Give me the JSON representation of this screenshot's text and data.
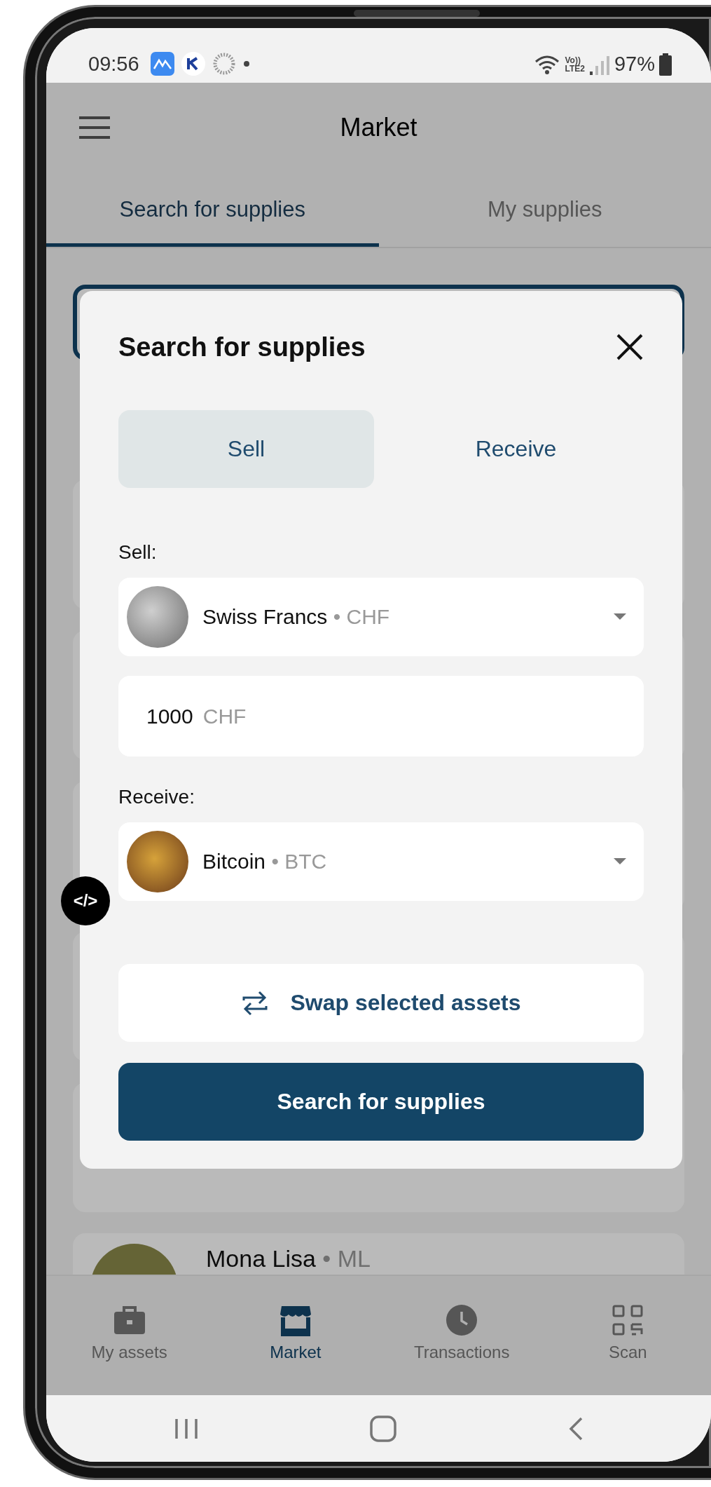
{
  "status_bar": {
    "time": "09:56",
    "network_top": "Vo))",
    "network_bottom": "LTE2",
    "battery": "97%"
  },
  "app_bar": {
    "title": "Market"
  },
  "tabs": [
    {
      "label": "Search for supplies",
      "selected": true
    },
    {
      "label": "My supplies",
      "selected": false
    }
  ],
  "background_list": [
    {
      "name": "Mona Lisa",
      "separator": "•",
      "code": "ML"
    }
  ],
  "dialog": {
    "title": "Search for supplies",
    "modes": [
      {
        "label": "Sell",
        "selected": true
      },
      {
        "label": "Receive",
        "selected": false
      }
    ],
    "fields": [
      {
        "kind": "select",
        "label": "Sell:",
        "asset": "Swiss Francs",
        "separator": "•",
        "code": "CHF"
      },
      {
        "kind": "amount",
        "value": "1000",
        "unit": "CHF"
      },
      {
        "kind": "select",
        "label": "Receive:",
        "asset": "Bitcoin",
        "separator": "•",
        "code": "BTC"
      }
    ],
    "swap_button": "Swap selected assets",
    "submit_button": "Search for supplies"
  },
  "bottom_nav": [
    {
      "label": "My assets",
      "selected": false
    },
    {
      "label": "Market",
      "selected": true
    },
    {
      "label": "Transactions",
      "selected": false
    },
    {
      "label": "Scan",
      "selected": false
    }
  ],
  "dev_badge": "</>"
}
